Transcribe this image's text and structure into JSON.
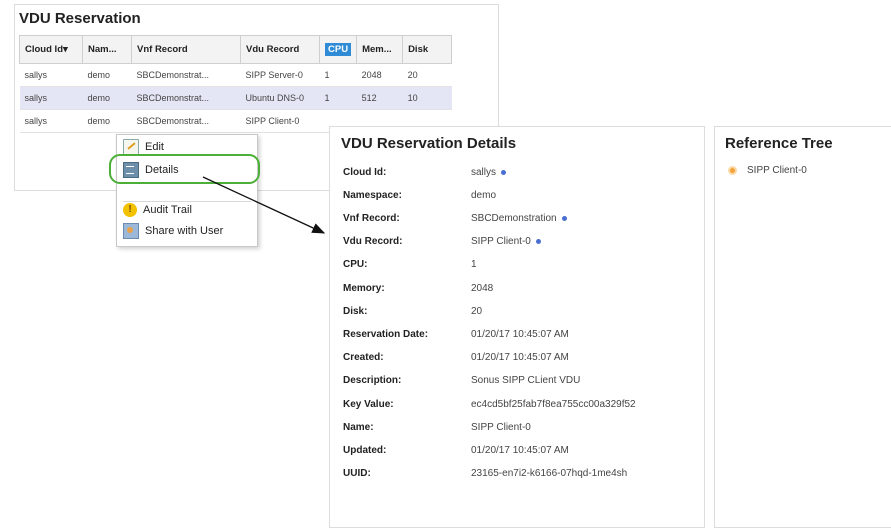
{
  "reservation": {
    "title": "VDU Reservation",
    "columns": [
      "Cloud Id",
      "Nam...",
      "Vnf Record",
      "Vdu Record",
      "CPU",
      "Mem...",
      "Disk"
    ],
    "rows": [
      [
        "sallys",
        "demo",
        "SBCDemonstrat...",
        "SIPP Server-0",
        "1",
        "2048",
        "20"
      ],
      [
        "sallys",
        "demo",
        "SBCDemonstrat...",
        "Ubuntu DNS-0",
        "1",
        "512",
        "10"
      ],
      [
        "sallys",
        "demo",
        "SBCDemonstrat...",
        "SIPP Client-0",
        "",
        "",
        ""
      ]
    ],
    "sort_indicator": "▾"
  },
  "context_menu": {
    "items": [
      {
        "label": "Edit",
        "icon": "edit-icon"
      },
      {
        "label": "Details",
        "icon": "details-icon"
      },
      {
        "label": "Audit Trail",
        "icon": "audit-icon"
      },
      {
        "label": "Share with User",
        "icon": "share-icon"
      }
    ]
  },
  "details": {
    "title": "VDU Reservation Details",
    "fields": [
      {
        "label": "Cloud Id:",
        "value": "sallys",
        "link": true
      },
      {
        "label": "Namespace:",
        "value": "demo",
        "link": false
      },
      {
        "label": "Vnf Record:",
        "value": "SBCDemonstration",
        "link": true
      },
      {
        "label": "Vdu Record:",
        "value": "SIPP Client-0",
        "link": true
      },
      {
        "label": "CPU:",
        "value": "1",
        "link": false
      },
      {
        "label": "Memory:",
        "value": "2048",
        "link": false
      },
      {
        "label": "Disk:",
        "value": "20",
        "link": false
      },
      {
        "label": "Reservation Date:",
        "value": "01/20/17 10:45:07 AM",
        "link": false
      },
      {
        "label": "Created:",
        "value": "01/20/17 10:45:07 AM",
        "link": false
      },
      {
        "label": "Description:",
        "value": "Sonus SIPP CLient VDU",
        "link": false
      },
      {
        "label": "Key Value:",
        "value": "ec4cd5bf25fab7f8ea755cc00a329f52",
        "link": false
      },
      {
        "label": "Name:",
        "value": "SIPP Client-0",
        "link": false
      },
      {
        "label": "Updated:",
        "value": "01/20/17 10:45:07 AM",
        "link": false
      },
      {
        "label": "UUID:",
        "value": "23165-en7i2-k6166-07hqd-1me4sh",
        "link": false
      }
    ]
  },
  "reference_tree": {
    "title": "Reference Tree",
    "node": "SIPP Client-0"
  },
  "colors": {
    "selected_row": "#e4e6f5",
    "highlight_callout": "#4caf37",
    "link_dot": "#4a6fd0"
  }
}
